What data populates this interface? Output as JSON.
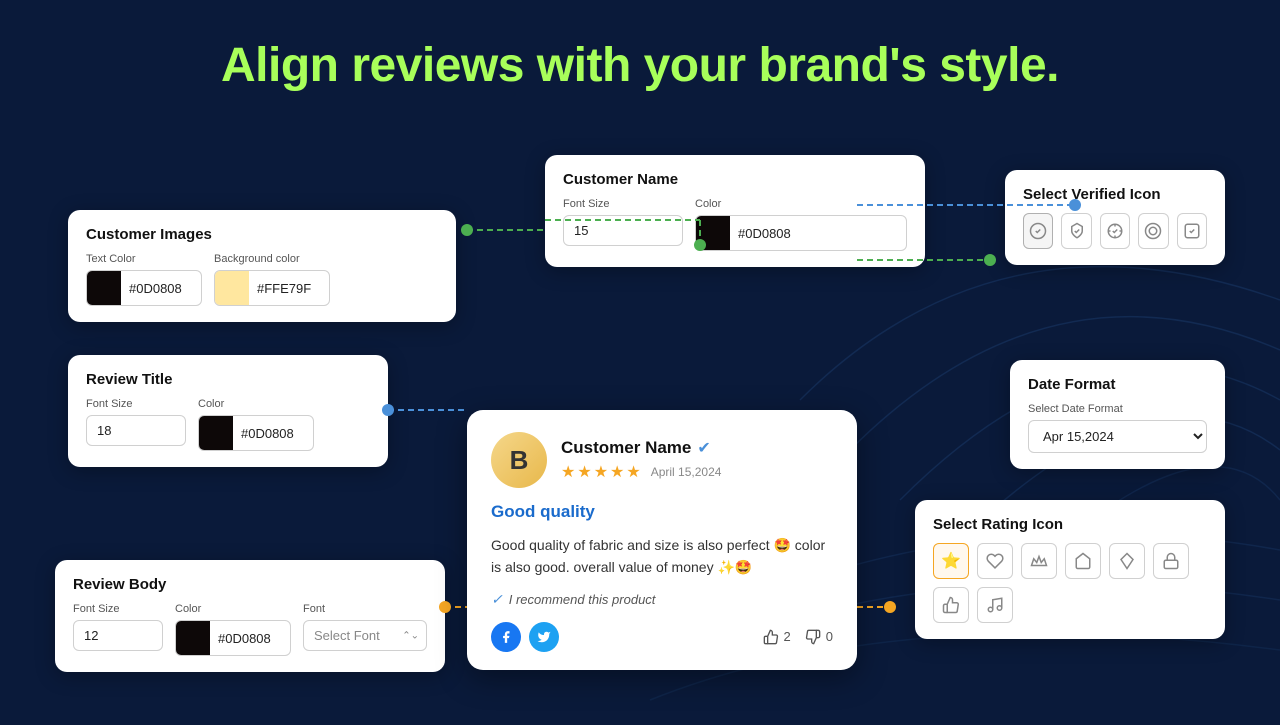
{
  "header": {
    "title_plain": "Align reviews with your ",
    "title_highlight": "brand's style.",
    "title_full": "Align reviews with your brand's style."
  },
  "panel_customer_images": {
    "title": "Customer Images",
    "text_color_label": "Text Color",
    "text_color_value": "#0D0808",
    "bg_color_label": "Background color",
    "bg_color_value": "#FFE79F"
  },
  "panel_review_title": {
    "title": "Review Title",
    "font_size_label": "Font Size",
    "font_size_value": "18",
    "color_label": "Color",
    "color_value": "#0D0808"
  },
  "panel_review_body": {
    "title": "Review Body",
    "font_size_label": "Font Size",
    "font_size_value": "12",
    "color_label": "Color",
    "color_value": "#0D0808",
    "font_label": "Font",
    "font_value": "Select Font"
  },
  "panel_customer_name": {
    "title": "Customer Name",
    "font_size_label": "Font Size",
    "font_size_value": "15",
    "color_label": "Color",
    "color_value": "#0D0808"
  },
  "panel_date_format": {
    "title": "Date Format",
    "select_label": "Select Date Format",
    "selected_value": "Apr 15,2024"
  },
  "panel_verified_icon": {
    "title": "Select Verified Icon",
    "icons": [
      "circle-check",
      "shield-check",
      "badge-check",
      "circle-check-outline",
      "square-check"
    ]
  },
  "panel_rating_icon": {
    "title": "Select Rating Icon",
    "icons": [
      "star",
      "heart",
      "crown",
      "home",
      "diamond",
      "lock",
      "thumbs-up",
      "music"
    ]
  },
  "review_card": {
    "avatar_letter": "B",
    "customer_name": "Customer Name",
    "verified": true,
    "stars": 5,
    "date": "April 15,2024",
    "title": "Good quality",
    "body": "Good quality of fabric and size is also perfect 🤩 color is also good. overall value of money ✨🤩",
    "recommend_text": "I recommend this product",
    "likes": 2,
    "dislikes": 0
  }
}
